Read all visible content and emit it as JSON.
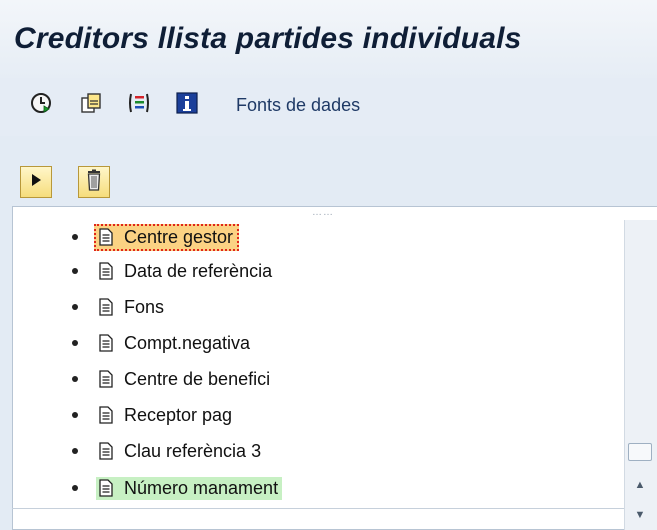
{
  "window": {
    "title": "Creditors llista partides individuals"
  },
  "toolbar": {
    "icons": [
      "execute-clock-icon",
      "copy-variant-icon",
      "columns-icon",
      "info-icon"
    ],
    "data_sources_label": "Fonts de dades"
  },
  "actions": {
    "buttons": [
      "execute-icon",
      "delete-icon"
    ]
  },
  "field_list": {
    "items": [
      {
        "label": "Centre gestor",
        "state": "focused"
      },
      {
        "label": "Data de referència",
        "state": "normal"
      },
      {
        "label": "Fons",
        "state": "normal"
      },
      {
        "label": "Compt.negativa",
        "state": "normal"
      },
      {
        "label": "Centre de benefici",
        "state": "normal"
      },
      {
        "label": "Receptor pag",
        "state": "normal"
      },
      {
        "label": "Clau referència 3",
        "state": "normal"
      },
      {
        "label": "Número manament",
        "state": "highlighted"
      }
    ]
  },
  "colors": {
    "background": "#e3ebf4",
    "focus_fill": "#fbd283",
    "focus_border": "#e0261b",
    "highlight_fill": "#c7f0c3",
    "link": "#1f3a66"
  }
}
